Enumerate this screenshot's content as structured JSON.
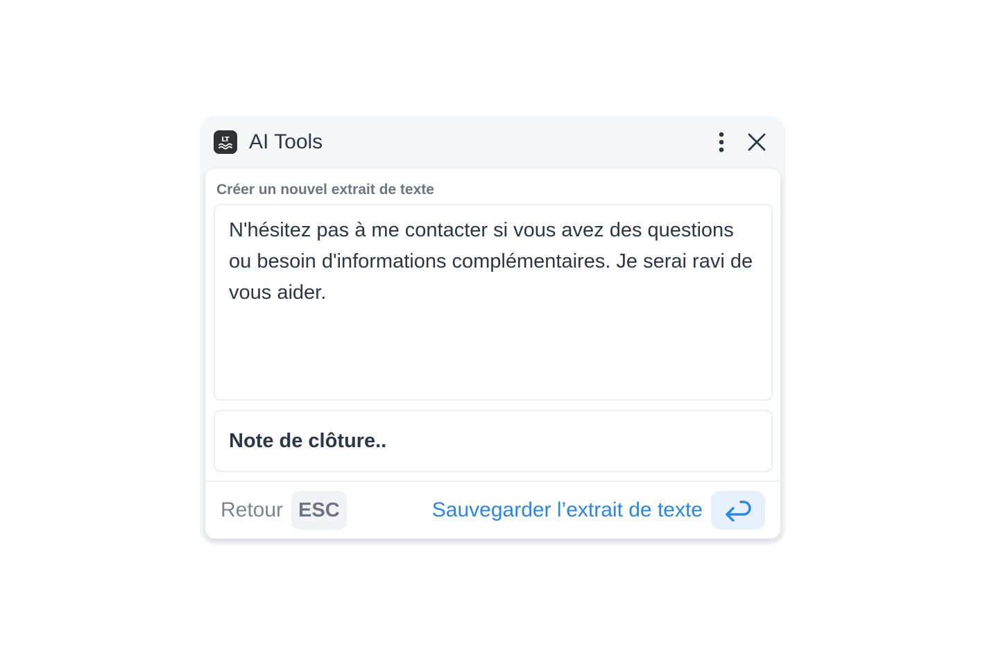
{
  "header": {
    "title": "AI Tools",
    "logo_text": "LT"
  },
  "form": {
    "section_label": "Créer un nouvel extrait de texte",
    "snippet_text": "N'hésitez pas à me contacter si vous avez des questions ou besoin d'informations complémentaires. Je serai ravi de vous aider.",
    "note_placeholder": "Note de clôture.."
  },
  "footer": {
    "back_label": "Retour",
    "back_key": "ESC",
    "save_label": "Sauvegarder l’extrait de texte"
  },
  "icons": {
    "logo": "languagetool-logo-icon",
    "menu": "more-vertical-icon",
    "close": "close-icon",
    "enter": "enter-return-icon"
  },
  "colors": {
    "accent": "#2787e8",
    "accent_bg": "#e6f1fd",
    "text": "#2b3648",
    "muted": "#6d7583",
    "panel_bg": "#f6f7f9"
  }
}
